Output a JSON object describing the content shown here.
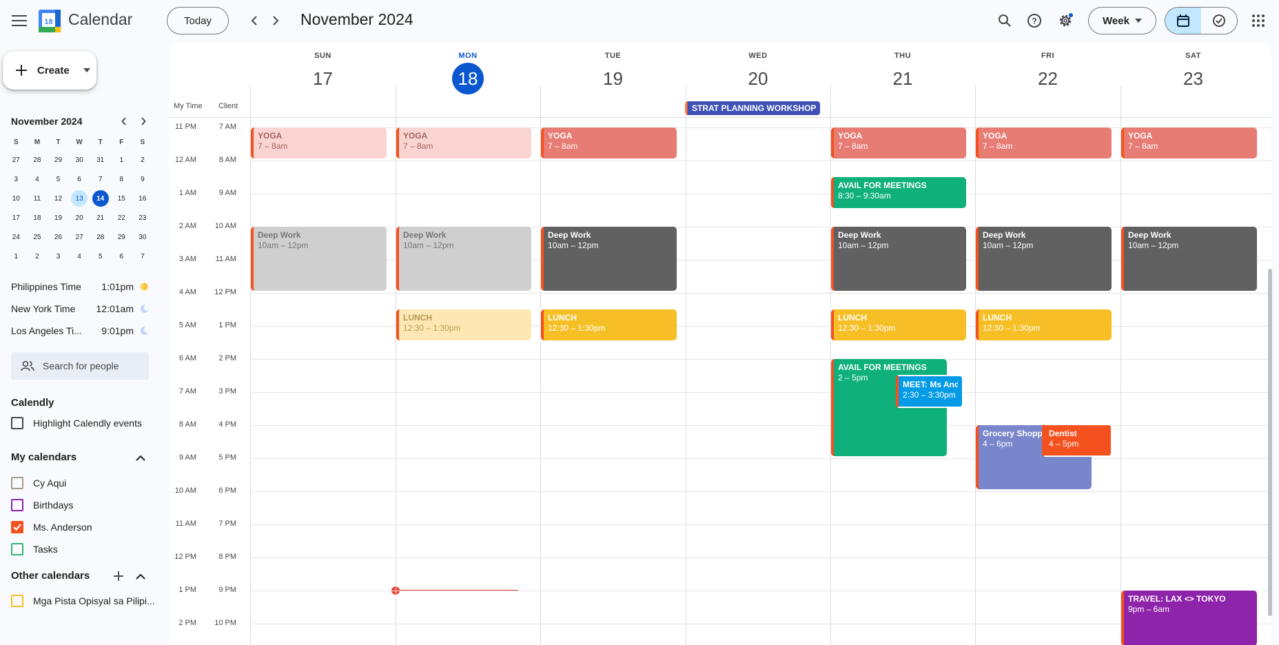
{
  "header": {
    "app_title": "Calendar",
    "logo_number": "18",
    "today_label": "Today",
    "period_title": "November 2024",
    "view_label": "Week"
  },
  "sidebar": {
    "create_label": "Create",
    "mini_calendar": {
      "title": "November 2024",
      "weekday_initials": [
        "S",
        "M",
        "T",
        "W",
        "T",
        "F",
        "S"
      ],
      "days": [
        "27",
        "28",
        "29",
        "30",
        "31",
        "1",
        "2",
        "3",
        "4",
        "5",
        "6",
        "7",
        "8",
        "9",
        "10",
        "11",
        "12",
        "13",
        "14",
        "15",
        "16",
        "17",
        "18",
        "19",
        "20",
        "21",
        "22",
        "23",
        "24",
        "25",
        "26",
        "27",
        "28",
        "29",
        "30",
        "1",
        "2",
        "3",
        "4",
        "5",
        "6",
        "7"
      ],
      "selected_day": "17",
      "today": "18"
    },
    "timezones": [
      {
        "name": "Philippines Time",
        "time": "1:01pm",
        "icon": "sun-icon"
      },
      {
        "name": "New York Time",
        "time": "12:01am",
        "icon": "moon-icon"
      },
      {
        "name": "Los Angeles Ti...",
        "time": "9:01pm",
        "icon": "moon-icon"
      }
    ],
    "people_search_placeholder": "Search for people",
    "calendly": {
      "title": "Calendly",
      "checkbox_label": "Highlight Calendly events"
    },
    "my_calendars": {
      "title": "My calendars",
      "items": [
        {
          "label": "Cy Aqui",
          "color": "#a79b8e",
          "checked": false
        },
        {
          "label": "Birthdays",
          "color": "#8e24aa",
          "checked": false
        },
        {
          "label": "Ms. Anderson",
          "color": "#f4511e",
          "checked": true
        },
        {
          "label": "Tasks",
          "color": "#33b679",
          "checked": false
        }
      ]
    },
    "other_calendars": {
      "title": "Other calendars",
      "items": [
        {
          "label": "Mga Pista Opisyal sa Pilipi...",
          "color": "#f6bf26",
          "checked": false
        }
      ]
    }
  },
  "week": {
    "days": [
      {
        "dow": "SUN",
        "num": "17"
      },
      {
        "dow": "MON",
        "num": "18"
      },
      {
        "dow": "TUE",
        "num": "19"
      },
      {
        "dow": "WED",
        "num": "20"
      },
      {
        "dow": "THU",
        "num": "21"
      },
      {
        "dow": "FRI",
        "num": "22"
      },
      {
        "dow": "SAT",
        "num": "23"
      }
    ],
    "today_index": 1,
    "tz_labels": [
      "My Time",
      "Client"
    ],
    "my_time_hours": [
      "11 PM",
      "12 AM",
      "1 AM",
      "2 AM",
      "3 AM",
      "4 AM",
      "5 AM",
      "6 AM",
      "7 AM",
      "8 AM",
      "9 AM",
      "10 AM",
      "11 AM",
      "12 PM",
      "1 PM",
      "2 PM"
    ],
    "client_hours": [
      "7 AM",
      "8 AM",
      "9 AM",
      "10 AM",
      "11 AM",
      "12 PM",
      "1 PM",
      "2 PM",
      "3 PM",
      "4 PM",
      "5 PM",
      "6 PM",
      "7 PM",
      "8 PM",
      "9 PM",
      "10 PM"
    ],
    "all_day_events": [
      {
        "title": "STRAT PLANNING WORKSHOP",
        "day": "20"
      }
    ],
    "events": [
      {
        "title": "YOGA",
        "time": "7 – 8am"
      },
      {
        "title": "YOGA",
        "time": "7 – 8am"
      },
      {
        "title": "YOGA",
        "time": "7 – 8am"
      },
      {
        "title": "YOGA",
        "time": "7 – 8am"
      },
      {
        "title": "YOGA",
        "time": "7 – 8am"
      },
      {
        "title": "YOGA",
        "time": "7 – 8am"
      },
      {
        "title": "AVAIL FOR MEETINGS",
        "time": "8:30 – 9:30am"
      },
      {
        "title": "Deep Work",
        "time": "10am – 12pm"
      },
      {
        "title": "Deep Work",
        "time": "10am – 12pm"
      },
      {
        "title": "Deep Work",
        "time": "10am – 12pm"
      },
      {
        "title": "Deep Work",
        "time": "10am – 12pm"
      },
      {
        "title": "Deep Work",
        "time": "10am – 12pm"
      },
      {
        "title": "Deep Work",
        "time": "10am – 12pm"
      },
      {
        "title": "LUNCH",
        "time": "12:30 – 1:30pm"
      },
      {
        "title": "LUNCH",
        "time": "12:30 – 1:30pm"
      },
      {
        "title": "LUNCH",
        "time": "12:30 – 1:30pm"
      },
      {
        "title": "LUNCH",
        "time": "12:30 – 1:30pm"
      },
      {
        "title": "AVAIL FOR MEETINGS",
        "time": "2 – 5pm"
      },
      {
        "title": "MEET: Ms Anderson",
        "time": "2:30 – 3:30pm"
      },
      {
        "title": "Grocery Shopping",
        "time": "4 – 6pm"
      },
      {
        "title": "Dentist",
        "time": "4 – 5pm"
      },
      {
        "title": "TRAVEL: LAX <> TOKYO",
        "time": "9pm – 6am"
      }
    ]
  }
}
